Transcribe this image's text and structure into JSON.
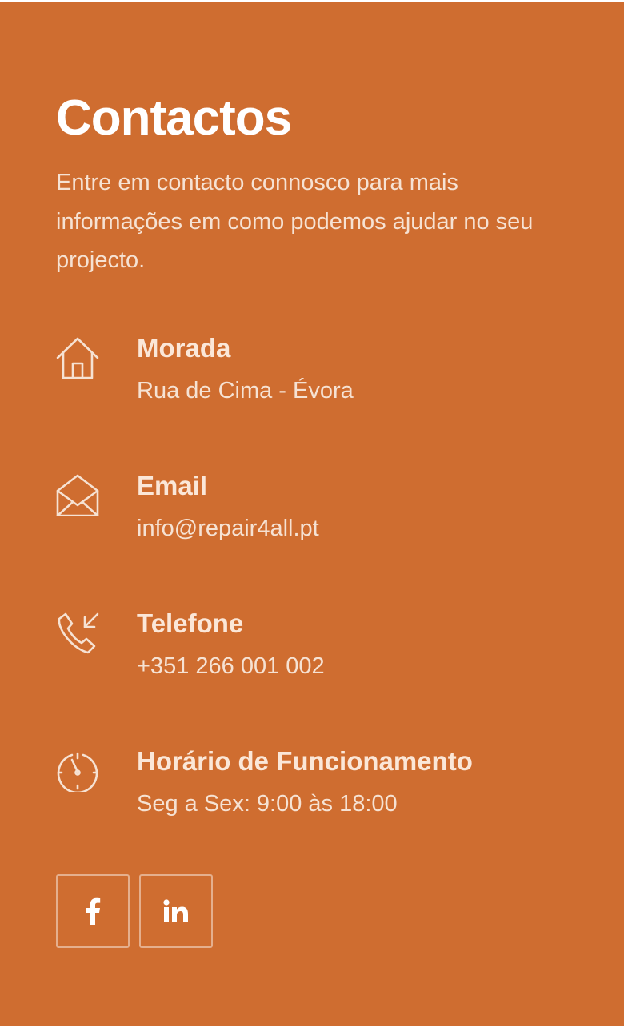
{
  "contact": {
    "title": "Contactos",
    "intro": "Entre em contacto connosco para mais informações em como podemos ajudar no seu projecto.",
    "items": [
      {
        "icon": "home-icon",
        "label": "Morada",
        "value": "Rua de Cima - Évora"
      },
      {
        "icon": "envelope-icon",
        "label": "Email",
        "value": "info@repair4all.pt"
      },
      {
        "icon": "phone-incoming-icon",
        "label": "Telefone",
        "value": "+351 266 001 002"
      },
      {
        "icon": "clock-icon",
        "label": "Horário de Funcionamento",
        "value": "Seg a Sex: 9:00 às 18:00"
      }
    ],
    "social": [
      {
        "icon": "facebook-icon",
        "name": "Facebook"
      },
      {
        "icon": "linkedin-icon",
        "name": "LinkedIn"
      }
    ]
  },
  "colors": {
    "background": "#CF6D30",
    "text": "#FFFFFF",
    "muted_text": "#F6E2D3"
  }
}
